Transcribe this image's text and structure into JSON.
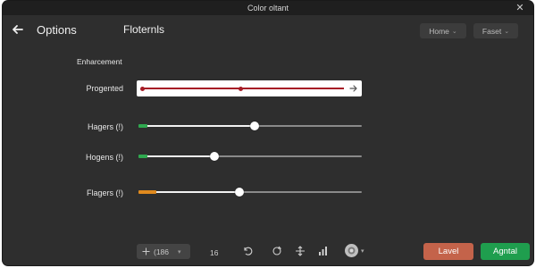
{
  "window": {
    "title": "Color oltant"
  },
  "header": {
    "title": "Options",
    "subtitle": "Floternls",
    "dropdown_home": "Home",
    "dropdown_faset": "Faset"
  },
  "section": {
    "label": "Enharcement"
  },
  "progress_row": {
    "label": "Progented",
    "value_fraction": 0.49,
    "color": "#a61c26"
  },
  "sliders": [
    {
      "label": "Hagers (!)",
      "value": 0.52,
      "accent_color": "#2fa84f"
    },
    {
      "label": "Hogens (!)",
      "value": 0.34,
      "accent_color": "#2fa84f"
    },
    {
      "label": "Flagers (!)",
      "value": 0.45,
      "accent_color": "#e08a1e"
    }
  ],
  "toolbar": {
    "zoom_value": "(186",
    "number": "16",
    "icons": [
      "zoom-icon",
      "rotate-icon",
      "crop-icon",
      "move-icon",
      "histogram-icon",
      "color-wheel-icon"
    ]
  },
  "buttons": {
    "secondary": "Lavel",
    "primary": "Agntal"
  },
  "colors": {
    "window_bg": "#2e2e2e",
    "titlebar_bg": "#1f1f1f",
    "secondary_button": "#c4634a",
    "primary_button": "#1f9e4e"
  }
}
